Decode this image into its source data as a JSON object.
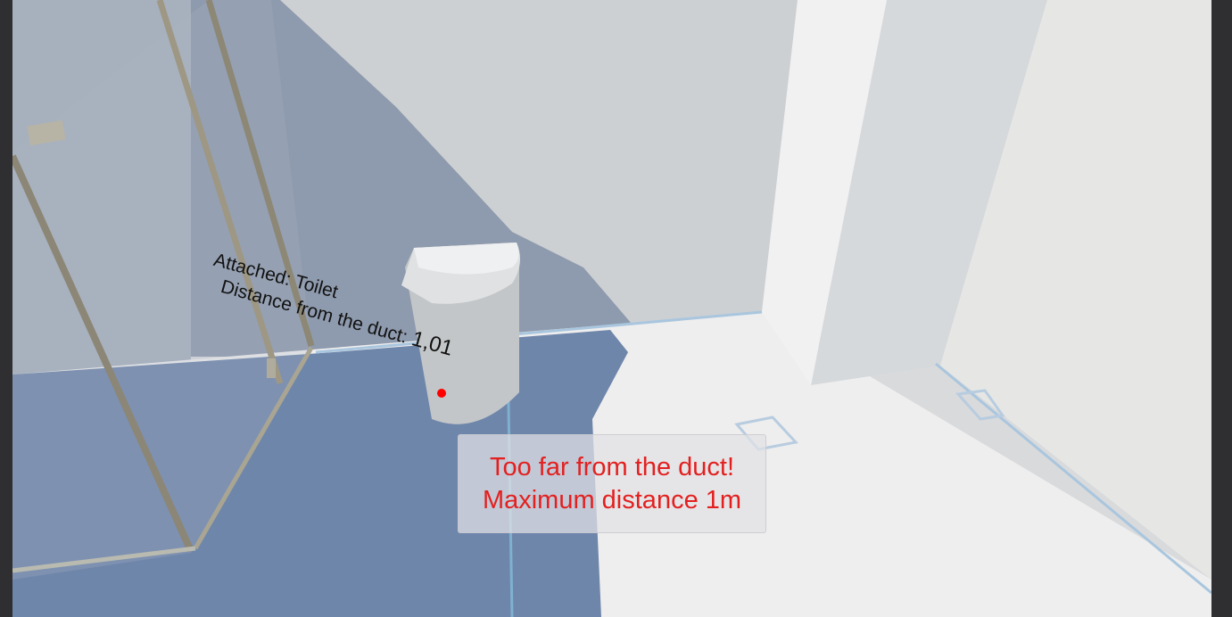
{
  "scene": {
    "description_icons": [
      "shower-enclosure",
      "toilet-model",
      "duct-column"
    ]
  },
  "attachment_label": {
    "attached_text": "Attached: Toilet",
    "distance_prefix": "Distance from the duct: ",
    "distance_value": "1,01"
  },
  "warning": {
    "line1": "Too far from the duct!",
    "line2": "Maximum distance 1m",
    "color": "#e32020"
  },
  "cursor": {
    "color": "#ff0000"
  }
}
